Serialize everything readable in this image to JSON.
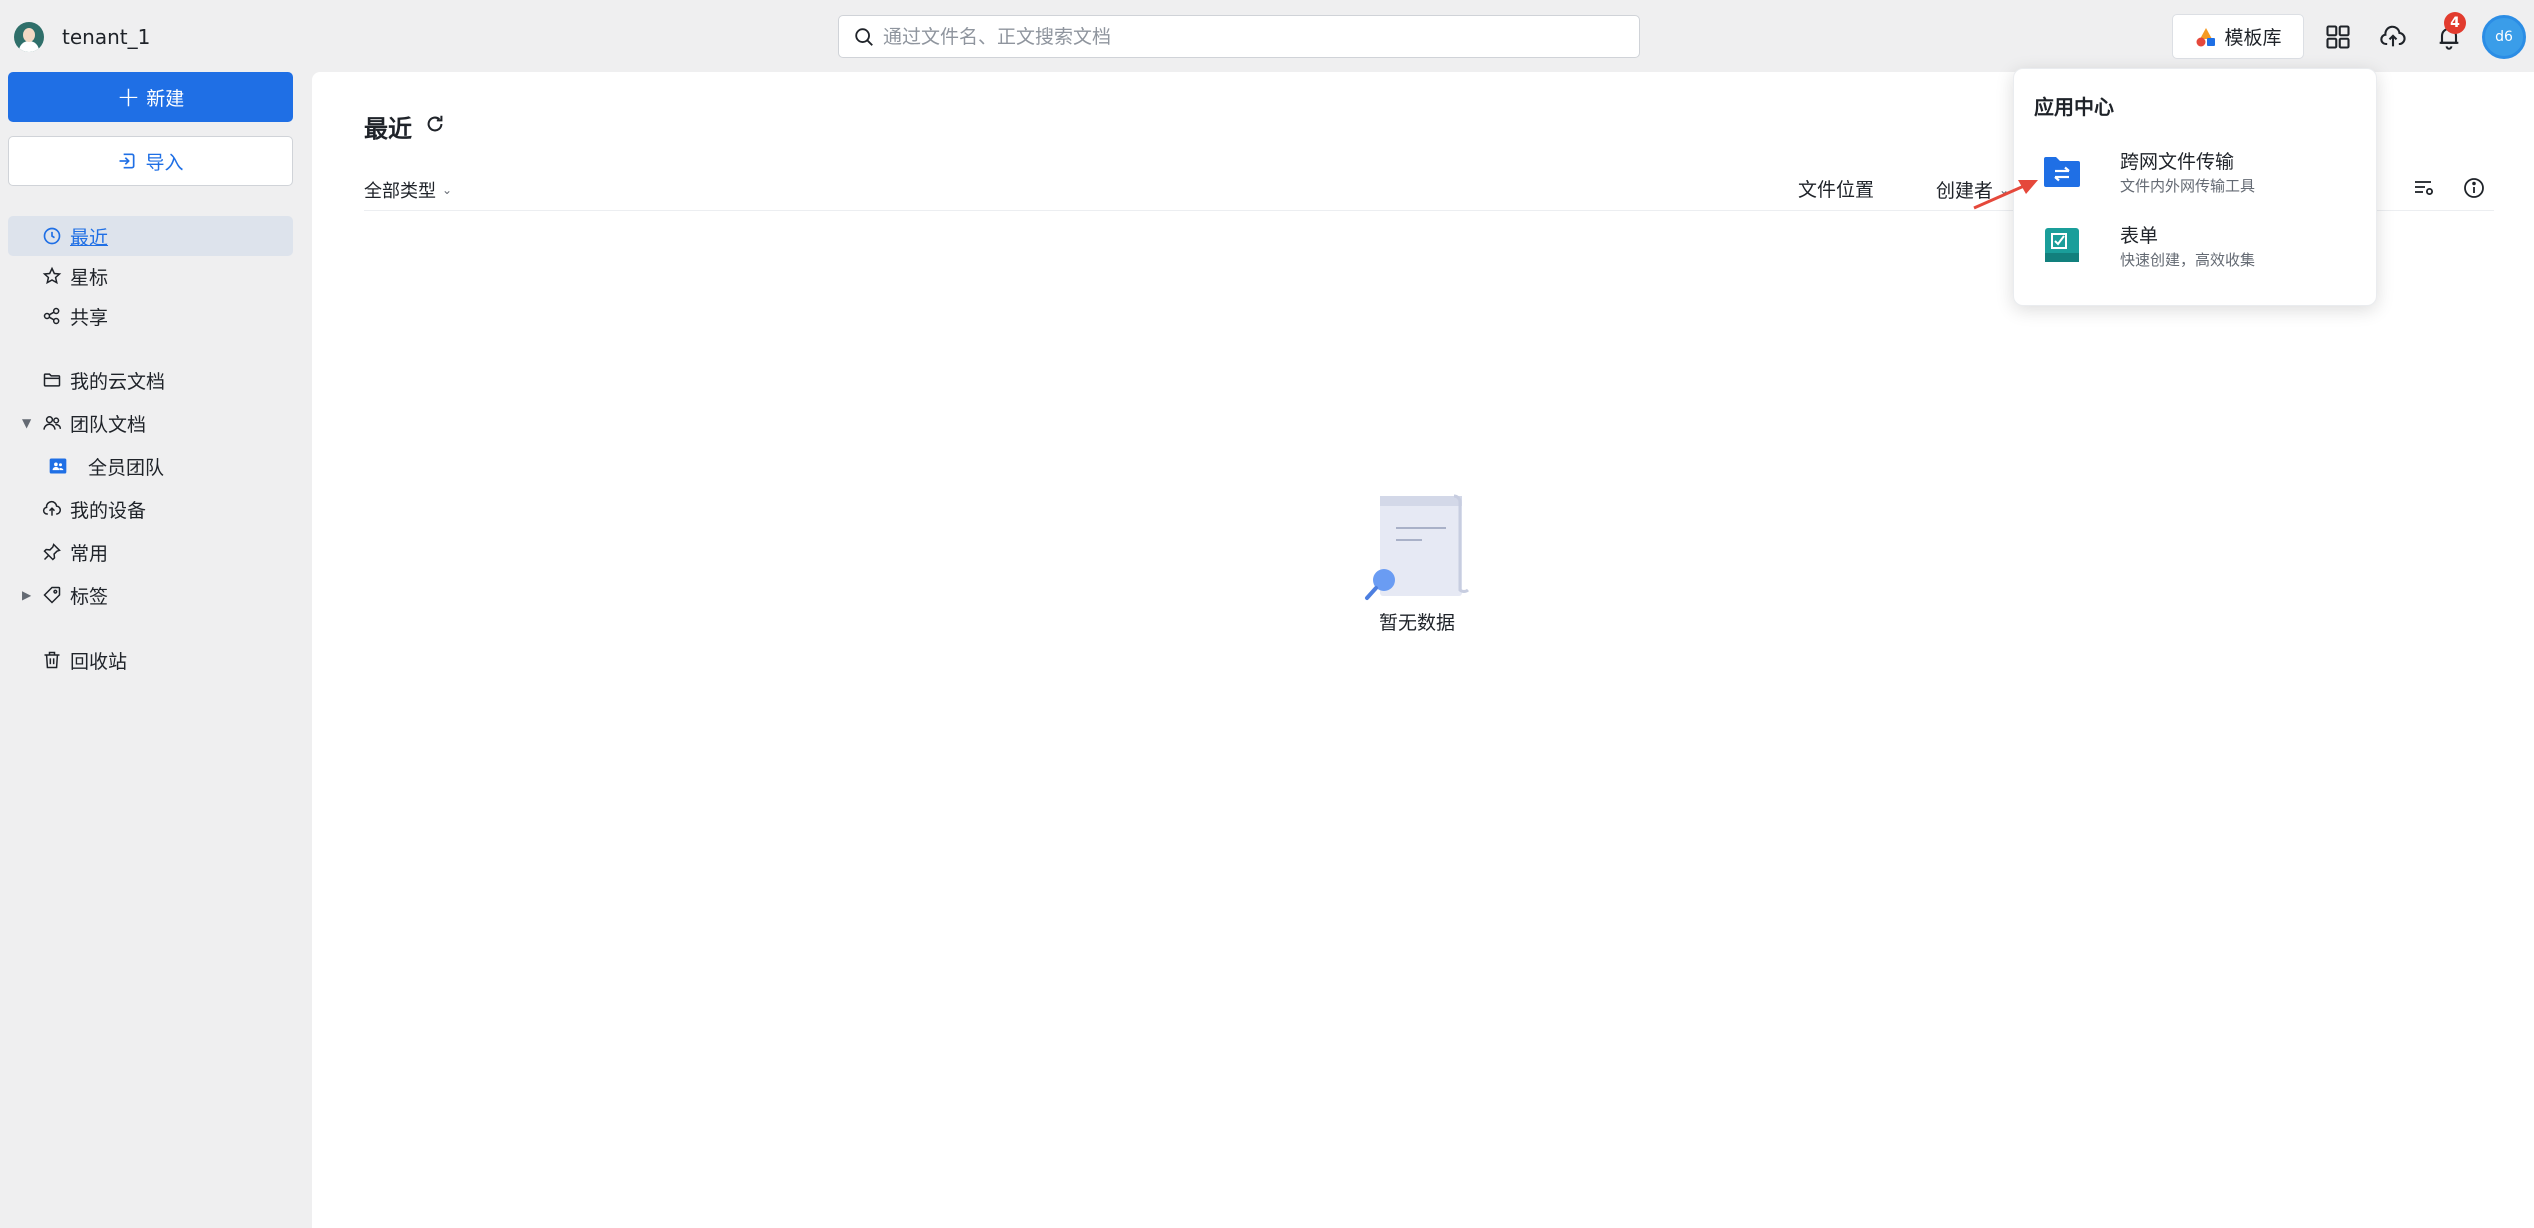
{
  "header": {
    "tenant_name": "tenant_1",
    "search_placeholder": "通过文件名、正文搜索文档",
    "template_label": "模板库",
    "notification_count": "4",
    "avatar_text": "d6"
  },
  "sidebar": {
    "new_label": "新建",
    "import_label": "导入",
    "items": [
      {
        "label": "最近",
        "icon": "clock-icon"
      },
      {
        "label": "星标",
        "icon": "star-icon"
      },
      {
        "label": "共享",
        "icon": "share-icon"
      },
      {
        "label": "我的云文档",
        "icon": "folder-icon"
      },
      {
        "label": "团队文档",
        "icon": "team-icon"
      },
      {
        "label": "全员团队",
        "icon": "team-folder-icon"
      },
      {
        "label": "我的设备",
        "icon": "cloud-upload-icon"
      },
      {
        "label": "常用",
        "icon": "pin-icon"
      },
      {
        "label": "标签",
        "icon": "tag-icon"
      },
      {
        "label": "回收站",
        "icon": "trash-icon"
      }
    ]
  },
  "main": {
    "title": "最近",
    "type_filter": "全部类型",
    "col_location": "文件位置",
    "col_creator": "创建者",
    "empty_text": "暂无数据"
  },
  "app_center": {
    "title": "应用中心",
    "apps": [
      {
        "name": "跨网文件传输",
        "desc": "文件内外网传输工具",
        "icon": "file-transfer-icon"
      },
      {
        "name": "表单",
        "desc": "快速创建，高效收集",
        "icon": "form-icon"
      }
    ]
  },
  "colors": {
    "accent": "#1f6fe5",
    "badge": "#e23b2e",
    "annotation_arrow": "#e5483b",
    "form_icon": "#1a9e9a"
  }
}
